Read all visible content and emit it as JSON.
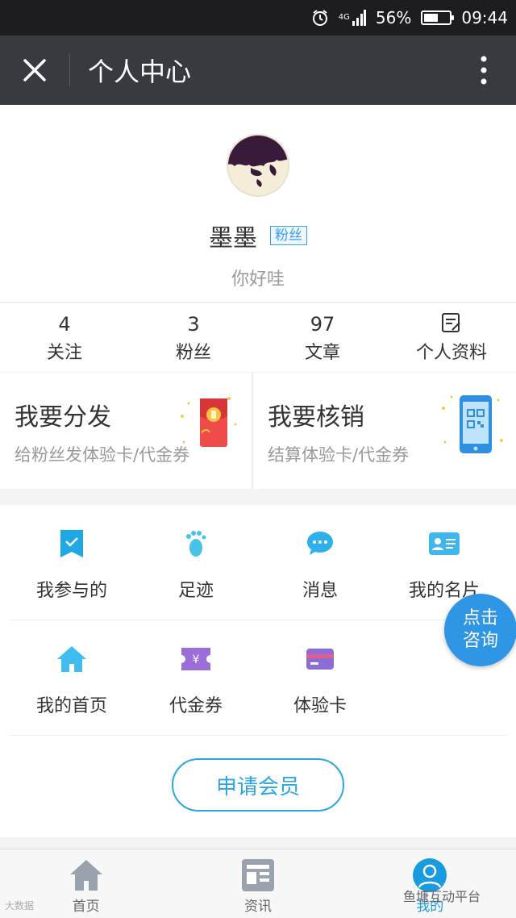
{
  "status_bar": {
    "network": "4G",
    "battery": "56%",
    "time": "09:44"
  },
  "header": {
    "title": "个人中心"
  },
  "profile": {
    "name": "墨墨",
    "badge": "粉丝",
    "signature": "你好哇"
  },
  "stats": [
    {
      "value": "4",
      "label": "关注"
    },
    {
      "value": "3",
      "label": "粉丝"
    },
    {
      "value": "97",
      "label": "文章"
    },
    {
      "icon": "edit-doc-icon",
      "label": "个人资料"
    }
  ],
  "promo": [
    {
      "title": "我要分发",
      "subtitle": "给粉丝发体验卡/代金券"
    },
    {
      "title": "我要核销",
      "subtitle": "结算体验卡/代金券"
    }
  ],
  "menu": {
    "row1": [
      {
        "label": "我参与的",
        "icon": "bookmark-check-icon"
      },
      {
        "label": "足迹",
        "icon": "footprint-icon"
      },
      {
        "label": "消息",
        "icon": "chat-bubble-icon"
      },
      {
        "label": "我的名片",
        "icon": "id-card-icon"
      }
    ],
    "row2": [
      {
        "label": "我的首页",
        "icon": "home-icon"
      },
      {
        "label": "代金券",
        "icon": "voucher-icon"
      },
      {
        "label": "体验卡",
        "icon": "card-icon"
      }
    ],
    "apply_label": "申请会员"
  },
  "consult_label": "点击咨询",
  "tabs": [
    {
      "label": "首页",
      "icon": "home-icon"
    },
    {
      "label": "资讯",
      "icon": "news-icon"
    },
    {
      "label": "我的",
      "icon": "user-icon",
      "active": true
    }
  ],
  "watermark": {
    "left": "大数据",
    "right": "鱼塘互动平台"
  },
  "colors": {
    "accent": "#2aa6e5",
    "header_bg": "#393a3f",
    "status_bg": "#1d1d1f"
  }
}
